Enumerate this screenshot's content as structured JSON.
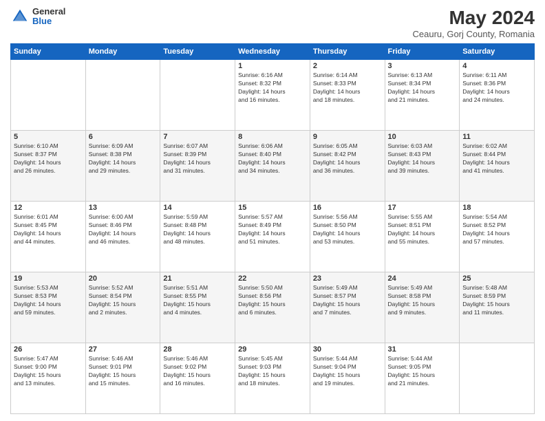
{
  "header": {
    "logo_general": "General",
    "logo_blue": "Blue",
    "title": "May 2024",
    "subtitle": "Ceauru, Gorj County, Romania"
  },
  "calendar": {
    "days_of_week": [
      "Sunday",
      "Monday",
      "Tuesday",
      "Wednesday",
      "Thursday",
      "Friday",
      "Saturday"
    ],
    "weeks": [
      [
        {
          "day": "",
          "info": ""
        },
        {
          "day": "",
          "info": ""
        },
        {
          "day": "",
          "info": ""
        },
        {
          "day": "1",
          "info": "Sunrise: 6:16 AM\nSunset: 8:32 PM\nDaylight: 14 hours\nand 16 minutes."
        },
        {
          "day": "2",
          "info": "Sunrise: 6:14 AM\nSunset: 8:33 PM\nDaylight: 14 hours\nand 18 minutes."
        },
        {
          "day": "3",
          "info": "Sunrise: 6:13 AM\nSunset: 8:34 PM\nDaylight: 14 hours\nand 21 minutes."
        },
        {
          "day": "4",
          "info": "Sunrise: 6:11 AM\nSunset: 8:36 PM\nDaylight: 14 hours\nand 24 minutes."
        }
      ],
      [
        {
          "day": "5",
          "info": "Sunrise: 6:10 AM\nSunset: 8:37 PM\nDaylight: 14 hours\nand 26 minutes."
        },
        {
          "day": "6",
          "info": "Sunrise: 6:09 AM\nSunset: 8:38 PM\nDaylight: 14 hours\nand 29 minutes."
        },
        {
          "day": "7",
          "info": "Sunrise: 6:07 AM\nSunset: 8:39 PM\nDaylight: 14 hours\nand 31 minutes."
        },
        {
          "day": "8",
          "info": "Sunrise: 6:06 AM\nSunset: 8:40 PM\nDaylight: 14 hours\nand 34 minutes."
        },
        {
          "day": "9",
          "info": "Sunrise: 6:05 AM\nSunset: 8:42 PM\nDaylight: 14 hours\nand 36 minutes."
        },
        {
          "day": "10",
          "info": "Sunrise: 6:03 AM\nSunset: 8:43 PM\nDaylight: 14 hours\nand 39 minutes."
        },
        {
          "day": "11",
          "info": "Sunrise: 6:02 AM\nSunset: 8:44 PM\nDaylight: 14 hours\nand 41 minutes."
        }
      ],
      [
        {
          "day": "12",
          "info": "Sunrise: 6:01 AM\nSunset: 8:45 PM\nDaylight: 14 hours\nand 44 minutes."
        },
        {
          "day": "13",
          "info": "Sunrise: 6:00 AM\nSunset: 8:46 PM\nDaylight: 14 hours\nand 46 minutes."
        },
        {
          "day": "14",
          "info": "Sunrise: 5:59 AM\nSunset: 8:48 PM\nDaylight: 14 hours\nand 48 minutes."
        },
        {
          "day": "15",
          "info": "Sunrise: 5:57 AM\nSunset: 8:49 PM\nDaylight: 14 hours\nand 51 minutes."
        },
        {
          "day": "16",
          "info": "Sunrise: 5:56 AM\nSunset: 8:50 PM\nDaylight: 14 hours\nand 53 minutes."
        },
        {
          "day": "17",
          "info": "Sunrise: 5:55 AM\nSunset: 8:51 PM\nDaylight: 14 hours\nand 55 minutes."
        },
        {
          "day": "18",
          "info": "Sunrise: 5:54 AM\nSunset: 8:52 PM\nDaylight: 14 hours\nand 57 minutes."
        }
      ],
      [
        {
          "day": "19",
          "info": "Sunrise: 5:53 AM\nSunset: 8:53 PM\nDaylight: 14 hours\nand 59 minutes."
        },
        {
          "day": "20",
          "info": "Sunrise: 5:52 AM\nSunset: 8:54 PM\nDaylight: 15 hours\nand 2 minutes."
        },
        {
          "day": "21",
          "info": "Sunrise: 5:51 AM\nSunset: 8:55 PM\nDaylight: 15 hours\nand 4 minutes."
        },
        {
          "day": "22",
          "info": "Sunrise: 5:50 AM\nSunset: 8:56 PM\nDaylight: 15 hours\nand 6 minutes."
        },
        {
          "day": "23",
          "info": "Sunrise: 5:49 AM\nSunset: 8:57 PM\nDaylight: 15 hours\nand 7 minutes."
        },
        {
          "day": "24",
          "info": "Sunrise: 5:49 AM\nSunset: 8:58 PM\nDaylight: 15 hours\nand 9 minutes."
        },
        {
          "day": "25",
          "info": "Sunrise: 5:48 AM\nSunset: 8:59 PM\nDaylight: 15 hours\nand 11 minutes."
        }
      ],
      [
        {
          "day": "26",
          "info": "Sunrise: 5:47 AM\nSunset: 9:00 PM\nDaylight: 15 hours\nand 13 minutes."
        },
        {
          "day": "27",
          "info": "Sunrise: 5:46 AM\nSunset: 9:01 PM\nDaylight: 15 hours\nand 15 minutes."
        },
        {
          "day": "28",
          "info": "Sunrise: 5:46 AM\nSunset: 9:02 PM\nDaylight: 15 hours\nand 16 minutes."
        },
        {
          "day": "29",
          "info": "Sunrise: 5:45 AM\nSunset: 9:03 PM\nDaylight: 15 hours\nand 18 minutes."
        },
        {
          "day": "30",
          "info": "Sunrise: 5:44 AM\nSunset: 9:04 PM\nDaylight: 15 hours\nand 19 minutes."
        },
        {
          "day": "31",
          "info": "Sunrise: 5:44 AM\nSunset: 9:05 PM\nDaylight: 15 hours\nand 21 minutes."
        },
        {
          "day": "",
          "info": ""
        }
      ]
    ]
  }
}
